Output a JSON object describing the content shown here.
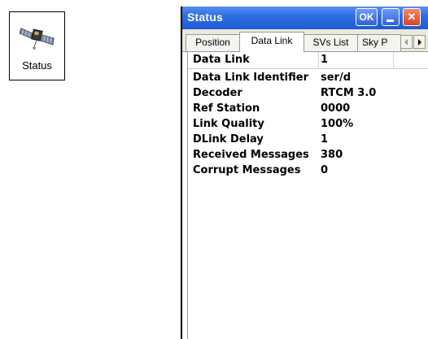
{
  "desktop_icon": {
    "label": "Status",
    "icon": "satellite-icon"
  },
  "window": {
    "title": "Status",
    "ok_label": "OK",
    "close_label": "✕"
  },
  "tabs": [
    {
      "label": "Position",
      "active": false
    },
    {
      "label": "Data Link",
      "active": true
    },
    {
      "label": "SVs List",
      "active": false
    },
    {
      "label": "Sky P",
      "active": false
    }
  ],
  "table": {
    "header": {
      "label": "Data Link",
      "value": "1"
    },
    "rows": [
      {
        "label": "Data Link Identifier",
        "value": "ser/d"
      },
      {
        "label": "Decoder",
        "value": "RTCM 3.0"
      },
      {
        "label": "Ref Station",
        "value": "0000"
      },
      {
        "label": "Link Quality",
        "value": "100%"
      },
      {
        "label": "DLink Delay",
        "value": "1"
      },
      {
        "label": "Received Messages",
        "value": "380"
      },
      {
        "label": "Corrupt Messages",
        "value": "0"
      }
    ]
  },
  "colors": {
    "titlebar": "#2f6fe3",
    "close_button": "#d5452a",
    "tab_strip": "#ece9d8"
  }
}
